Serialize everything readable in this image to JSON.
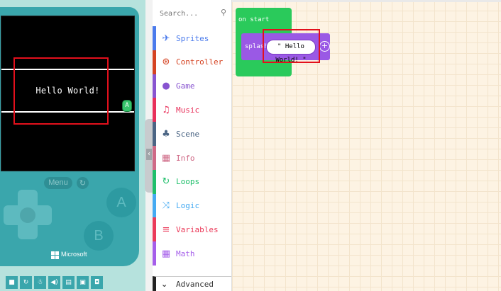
{
  "simulator": {
    "screen_text": "Hello World!",
    "sprite_glyph": "A",
    "menu_label": "Menu",
    "reset_glyph": "↻",
    "a_label": "A",
    "b_label": "B",
    "brand": "Microsoft",
    "toolbar_icons": [
      "stop-icon",
      "restart-icon",
      "debug-icon",
      "sound-icon",
      "keyboard-icon",
      "screenshot-icon",
      "record-icon"
    ],
    "toolbar_glyphs": [
      "■",
      "↻",
      "☃",
      "◀)",
      "▤",
      "▣",
      "◘"
    ]
  },
  "toolbox": {
    "search_placeholder": "Search...",
    "categories": [
      {
        "label": "Sprites",
        "icon": "paper-plane-icon",
        "glyph": "✈",
        "color": "#4b7bec"
      },
      {
        "label": "Controller",
        "icon": "gamepad-icon",
        "glyph": "⊛",
        "color": "#d54322"
      },
      {
        "label": "Game",
        "icon": "circle-icon",
        "glyph": "●",
        "color": "#8854d0"
      },
      {
        "label": "Music",
        "icon": "headphones-icon",
        "glyph": "♫",
        "color": "#e8305a"
      },
      {
        "label": "Scene",
        "icon": "tree-icon",
        "glyph": "♣",
        "color": "#4b6584"
      },
      {
        "label": "Info",
        "icon": "id-card-icon",
        "glyph": "▦",
        "color": "#cf6a87"
      },
      {
        "label": "Loops",
        "icon": "refresh-icon",
        "glyph": "↻",
        "color": "#20bf6b"
      },
      {
        "label": "Logic",
        "icon": "shuffle-icon",
        "glyph": "⤨",
        "color": "#45aaf2"
      },
      {
        "label": "Variables",
        "icon": "list-icon",
        "glyph": "≡",
        "color": "#eb3b5a"
      },
      {
        "label": "Math",
        "icon": "calculator-icon",
        "glyph": "▦",
        "color": "#a55eea"
      }
    ],
    "advanced_label": "Advanced",
    "advanced_glyph": "⌄"
  },
  "workspace": {
    "event_label": "on start",
    "block_label": "splash",
    "string_value": "\" Hello World! \"",
    "plus_glyph": "+"
  },
  "colors": {
    "event_green": "#2aca5b",
    "sprite_purple": "#9a59e5",
    "highlight_red": "#e3101c"
  }
}
